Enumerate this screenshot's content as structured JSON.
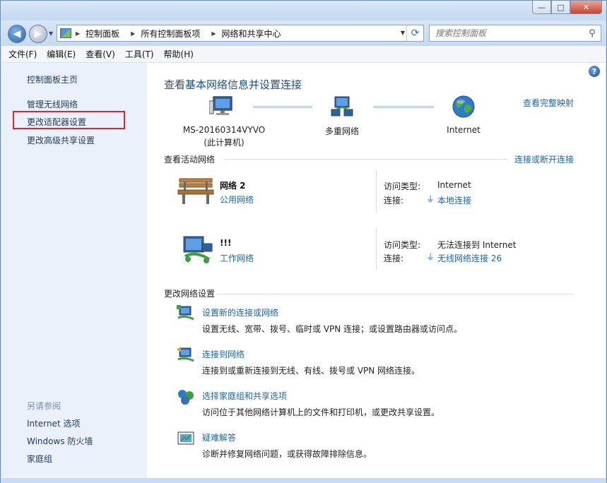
{
  "window": {
    "controls": {
      "minimize": "—",
      "maximize": "□",
      "close": "✕"
    }
  },
  "address_bar": {
    "breadcrumbs": [
      "控制面板",
      "所有控制面板项",
      "网络和共享中心"
    ],
    "search_placeholder": "搜索控制面板"
  },
  "menu": [
    "文件(F)",
    "编辑(E)",
    "查看(V)",
    "工具(T)",
    "帮助(H)"
  ],
  "sidebar": {
    "home": "控制面板主页",
    "items": [
      "管理无线网络",
      "更改适配器设置",
      "更改高级共享设置"
    ],
    "see_also_title": "另请参阅",
    "see_also": [
      "Internet 选项",
      "Windows 防火墙",
      "家庭组"
    ]
  },
  "main": {
    "title": "查看基本网络信息并设置连接",
    "view_full_map": "查看完整映射",
    "map": {
      "computer_name": "MS-20160314VYVO",
      "computer_sub": "(此计算机)",
      "middle": "多重网络",
      "internet": "Internet"
    },
    "active_title": "查看活动网络",
    "connect_disconnect": "连接或断开连接",
    "networks": [
      {
        "name": "网络  2",
        "type": "公用网络",
        "access_key": "访问类型:",
        "access_val": "Internet",
        "conn_key": "连接:",
        "conn_val": "本地连接"
      },
      {
        "name": "!!!",
        "type": "工作网络",
        "access_key": "访问类型:",
        "access_val": "无法连接到 Internet",
        "conn_key": "连接:",
        "conn_val": "无线网络连接 26"
      }
    ],
    "change_title": "更改网络设置",
    "tasks": [
      {
        "title": "设置新的连接或网络",
        "desc": "设置无线、宽带、拨号、临时或 VPN 连接；或设置路由器或访问点。"
      },
      {
        "title": "连接到网络",
        "desc": "连接到或重新连接到无线、有线、拨号或 VPN 网络连接。"
      },
      {
        "title": "选择家庭组和共享选项",
        "desc": "访问位于其他网络计算机上的文件和打印机，或更改共享设置。"
      },
      {
        "title": "疑难解答",
        "desc": "诊断并修复网络问题，或获得故障排除信息。"
      }
    ]
  },
  "colors": {
    "link": "#1a65b6",
    "heading": "#1c4f8c",
    "highlight": "#e0272c",
    "sidebar_bg": "#eaf1fb"
  }
}
